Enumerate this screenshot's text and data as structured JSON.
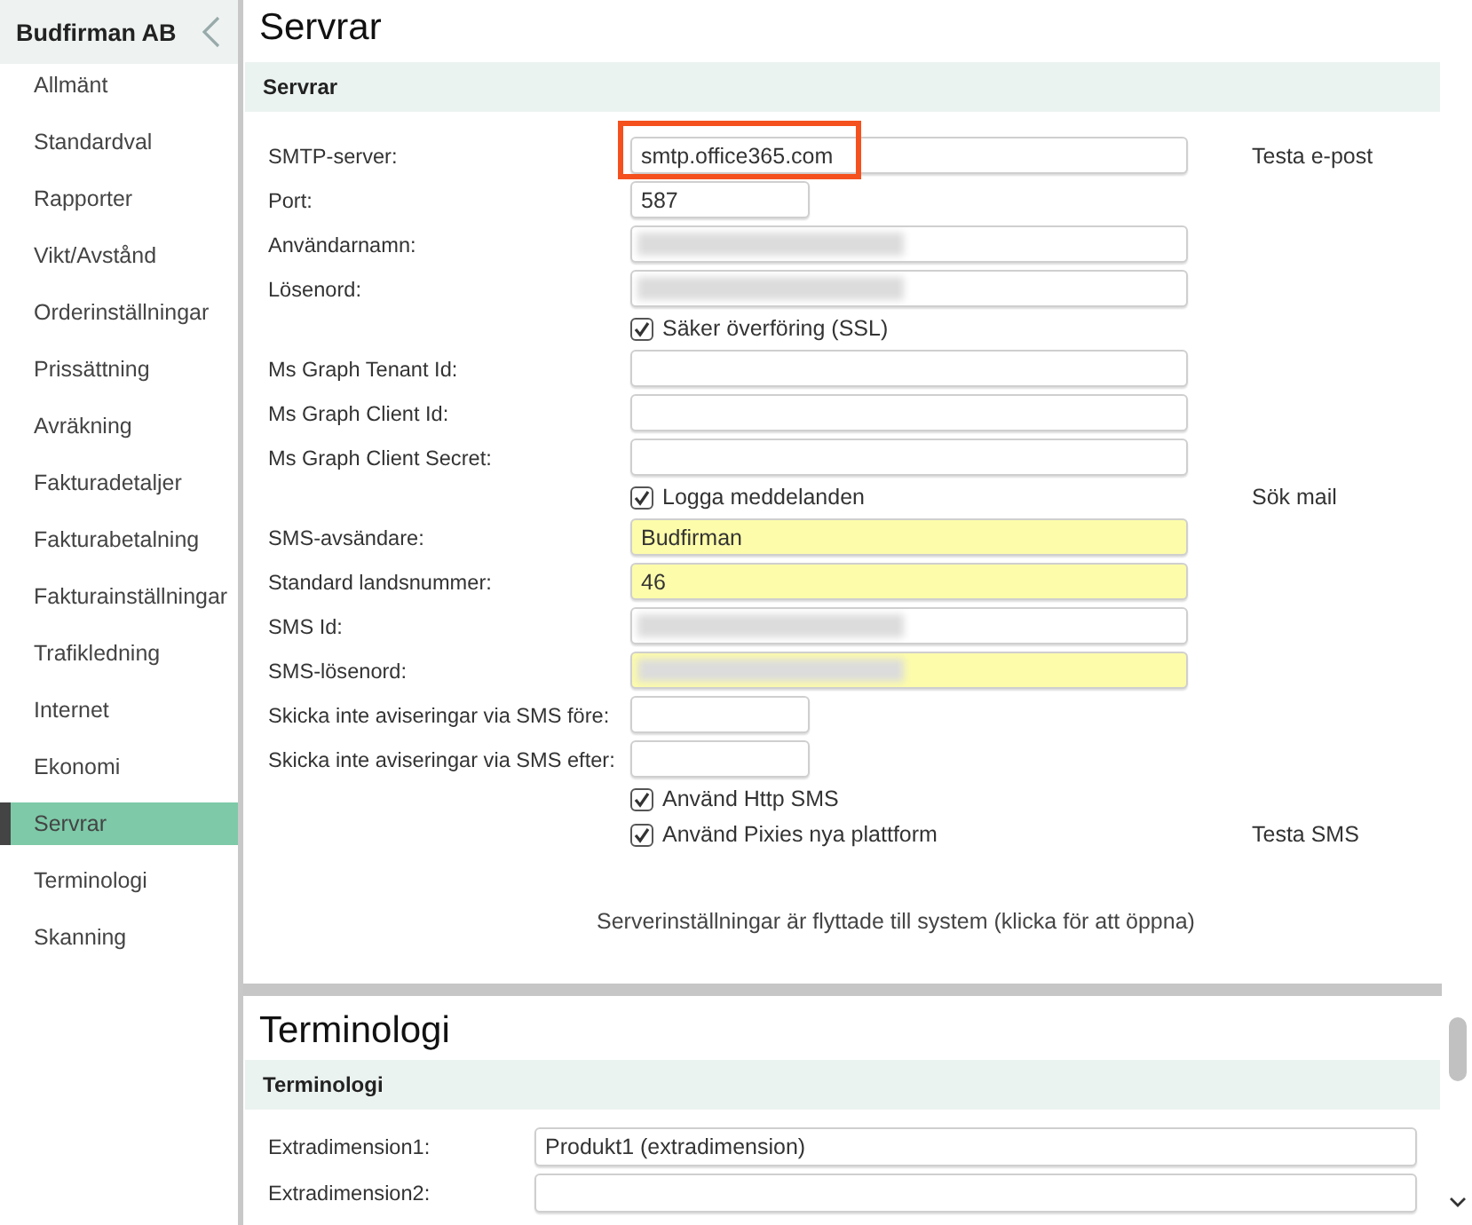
{
  "sidebar": {
    "title": "Budfirman AB",
    "items": [
      {
        "label": "Allmänt",
        "selected": false
      },
      {
        "label": "Standardval",
        "selected": false
      },
      {
        "label": "Rapporter",
        "selected": false
      },
      {
        "label": "Vikt/Avstånd",
        "selected": false
      },
      {
        "label": "Orderinställningar",
        "selected": false
      },
      {
        "label": "Prissättning",
        "selected": false
      },
      {
        "label": "Avräkning",
        "selected": false
      },
      {
        "label": "Fakturadetaljer",
        "selected": false
      },
      {
        "label": "Fakturabetalning",
        "selected": false
      },
      {
        "label": "Fakturainställningar",
        "selected": false
      },
      {
        "label": "Trafikledning",
        "selected": false
      },
      {
        "label": "Internet",
        "selected": false
      },
      {
        "label": "Ekonomi",
        "selected": false
      },
      {
        "label": "Servrar",
        "selected": true
      },
      {
        "label": "Terminologi",
        "selected": false
      },
      {
        "label": "Skanning",
        "selected": false
      }
    ]
  },
  "servers": {
    "title": "Servrar",
    "section": "Servrar",
    "rows": [
      {
        "kind": "input",
        "label": "SMTP-server:",
        "value": "smtp.office365.com",
        "short": false,
        "annotated": true,
        "highlighted": false,
        "action": "Testa e-post"
      },
      {
        "kind": "input",
        "label": "Port:",
        "value": "587",
        "short": true,
        "highlighted": false
      },
      {
        "kind": "input",
        "label": "Användarnamn:",
        "short": false,
        "highlighted": false,
        "blurred": true
      },
      {
        "kind": "input",
        "label": "Lösenord:",
        "short": false,
        "highlighted": false,
        "blurred": true
      },
      {
        "kind": "checkbox",
        "label": "Säker överföring (SSL)",
        "checked": true
      },
      {
        "kind": "input",
        "label": "Ms Graph Tenant Id:",
        "short": false,
        "highlighted": false
      },
      {
        "kind": "input",
        "label": "Ms Graph Client Id:",
        "short": false,
        "highlighted": false
      },
      {
        "kind": "input",
        "label": "Ms Graph Client Secret:",
        "short": false,
        "highlighted": false
      },
      {
        "kind": "checkbox",
        "label": "Logga meddelanden",
        "checked": true,
        "action": "Sök mail"
      },
      {
        "kind": "input",
        "label": "SMS-avsändare:",
        "value": "Budfirman",
        "short": false,
        "highlighted": true
      },
      {
        "kind": "input",
        "label": "Standard landsnummer:",
        "value": "46",
        "short": false,
        "highlighted": true
      },
      {
        "kind": "input",
        "label": "SMS Id:",
        "short": false,
        "highlighted": false,
        "blurred": true
      },
      {
        "kind": "input",
        "label": "SMS-lösenord:",
        "short": false,
        "highlighted": true,
        "blurred": true
      },
      {
        "kind": "input",
        "label": "Skicka inte aviseringar via SMS före:",
        "short": true,
        "highlighted": false
      },
      {
        "kind": "input",
        "label": "Skicka inte aviseringar via SMS efter:",
        "short": true,
        "highlighted": false
      },
      {
        "kind": "checkbox",
        "label": "Använd Http SMS",
        "checked": true
      },
      {
        "kind": "checkbox",
        "label": "Använd Pixies nya plattform",
        "checked": true,
        "action": "Testa SMS"
      }
    ],
    "note": "Serverinställningar är flyttade till system (klicka för att öppna)"
  },
  "terminology": {
    "title": "Terminologi",
    "section": "Terminologi",
    "rows": [
      {
        "label": "Extradimension1:",
        "value": "Produkt1 (extradimension)"
      },
      {
        "label": "Extradimension2:"
      }
    ]
  }
}
